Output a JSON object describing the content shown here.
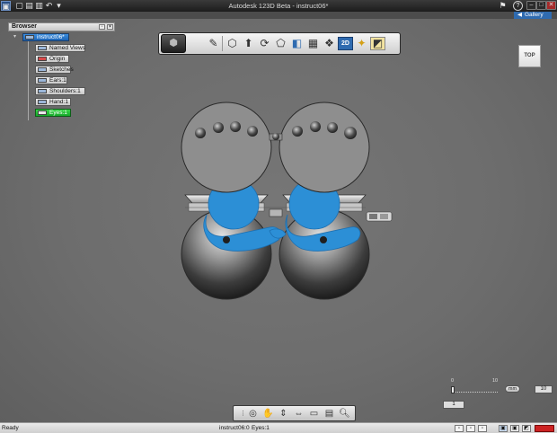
{
  "window": {
    "title": "Autodesk 123D Beta - instruct06*",
    "minimize_glyph": "–",
    "maximize_glyph": "□",
    "close_glyph": "✕",
    "quick_access_glyphs": [
      "▣",
      "▢",
      "▤",
      "▥",
      "↶",
      "▾"
    ],
    "help_glyph": "?",
    "sign_in_glyph": "⚑"
  },
  "gallery": {
    "label": "Gallery",
    "arrow": "◀"
  },
  "browser": {
    "title": "Browser",
    "root": "instruct06*",
    "items": [
      {
        "label": "Named Views"
      },
      {
        "label": "Origin"
      },
      {
        "label": "Sketches"
      },
      {
        "label": "Ears:1"
      },
      {
        "label": "Shoulders:1"
      },
      {
        "label": "Hand:1"
      },
      {
        "label": "Eyes:1"
      }
    ],
    "active_item": "Eyes:1"
  },
  "toolbar": {
    "icons": [
      "home-view-icon",
      "pencil-icon",
      "box-icon",
      "extrude-icon",
      "revolve-icon",
      "sweep-icon",
      "shell-icon",
      "pattern-icon",
      "combine-icon",
      "2d-view-icon",
      "render-icon",
      "material-icon"
    ],
    "label_2d": "2D"
  },
  "viewcube": {
    "label": "TOP"
  },
  "scale": {
    "min_label": "0",
    "max_label": "10",
    "unit": "mm",
    "value": "10",
    "field_value": "1"
  },
  "status": {
    "left": "Ready",
    "middle": "instruct06:0",
    "selection": "Eyes:1"
  },
  "colors": {
    "selection_blue": "#2c8fd6",
    "browser_root": "#1b63b5",
    "browser_active": "#16a82a",
    "gallery_tab": "#2f6bb0"
  }
}
